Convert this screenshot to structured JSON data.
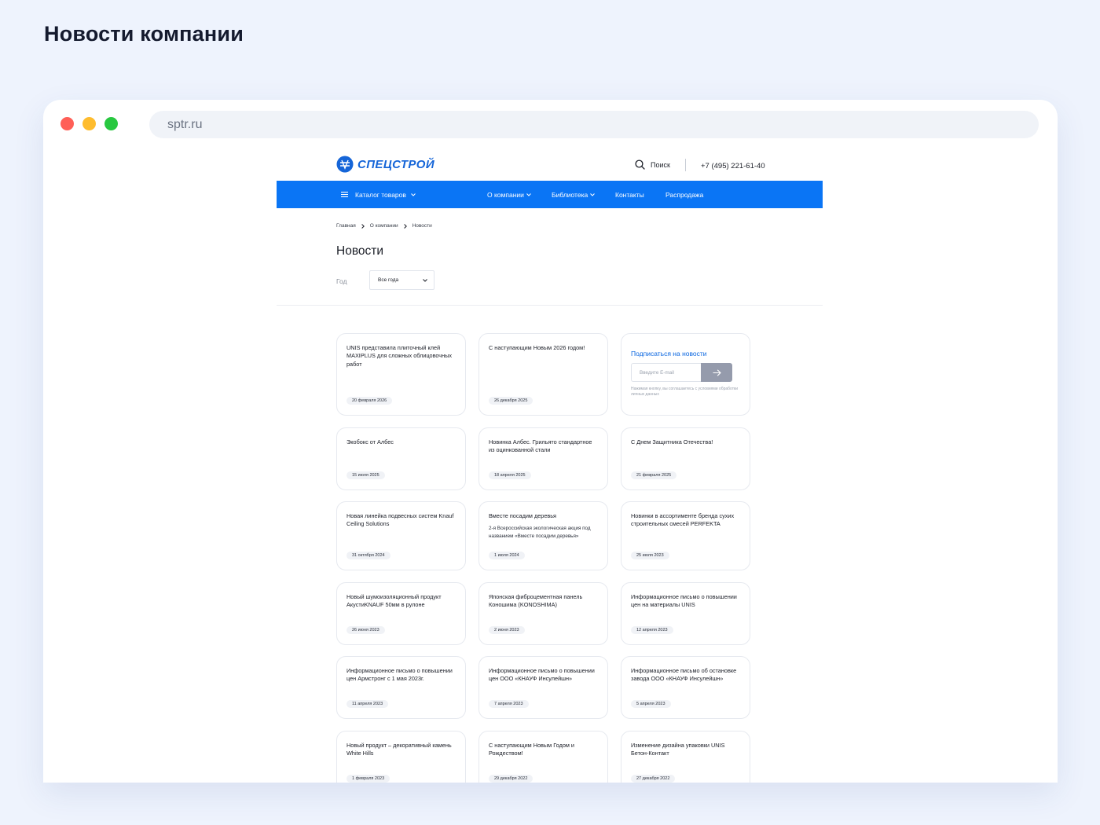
{
  "heading": "Новости компании",
  "browser": {
    "url": "sptr.ru"
  },
  "site": {
    "logo_text": "СПЕЦСТРОЙ",
    "search_label": "Поиск",
    "phone": "+7 (495) 221-61-40",
    "accent_color": "#0a75f5",
    "nav": {
      "catalog": "Каталог товаров",
      "about": "О компании",
      "library": "Библиотека",
      "contacts": "Контакты",
      "sale": "Распродажа"
    },
    "breadcrumb": [
      "Главная",
      "О компании",
      "Новости"
    ],
    "page_title": "Новости",
    "filter": {
      "label": "Год",
      "selected": "Все года"
    },
    "subscribe": {
      "title": "Подписаться на новости",
      "placeholder": "Введите E-mail",
      "consent": "Нажимая кнопку, вы соглашаетесь с условиями обработки личных данных"
    },
    "news": [
      {
        "title": "UNIS представила плиточный клей MAXIPLUS для сложных облицовочных работ",
        "date": "20 февраля 2026"
      },
      {
        "title": "С наступающим Новым 2026 годом!",
        "date": "26 декабря 2025"
      },
      {
        "title": "Экобокс от Албес",
        "date": "15 июля 2025"
      },
      {
        "title": "Новинка Албес. Грильято стандартное из оцинкованной стали",
        "date": "18 апреля 2025"
      },
      {
        "title": "С Днем Защитника Отечества!",
        "date": "21 февраля 2025"
      },
      {
        "title": "Новая линейка подвесных систем Knauf Ceiling Solutions",
        "date": "31 октября 2024"
      },
      {
        "title": "Вместе посадим деревья",
        "desc": "2-я Всероссийская экологическая акция под названием «Вместе посадим деревья»",
        "date": "1 июля 2024"
      },
      {
        "title": "Новинки в ассортименте бренда сухих строительных смесей PERFEKTA",
        "date": "25 июля 2023"
      },
      {
        "title": "Новый шумоизоляционный продукт АкустиKNAUF 50мм в рулоне",
        "date": "26 июня 2023"
      },
      {
        "title": "Японская фиброцементная панель Коношима (KONOSHIMA)",
        "date": "2 июня 2023"
      },
      {
        "title": "Информационное письмо о повышении цен на материалы UNIS",
        "date": "12 апреля 2023"
      },
      {
        "title": "Информационное письмо о повышении цен Армстронг с 1 мая 2023г.",
        "date": "11 апреля 2023"
      },
      {
        "title": "Информационное письмо о повышении цен ООО «КНАУФ Инсулейшн»",
        "date": "7 апреля 2023"
      },
      {
        "title": "Информационное письмо об остановке завода ООО «КНАУФ Инсулейшн»",
        "date": "5 апреля 2023"
      },
      {
        "title": "Новый продукт – декоративный камень White Hills",
        "date": "1 февраля 2023"
      },
      {
        "title": "С наступающим Новым Годом и Рождеством!",
        "date": "29 декабря 2022"
      },
      {
        "title": "Изменение дизайна упаковки UNIS Бетон-Контакт",
        "date": "27 декабря 2022"
      }
    ]
  }
}
